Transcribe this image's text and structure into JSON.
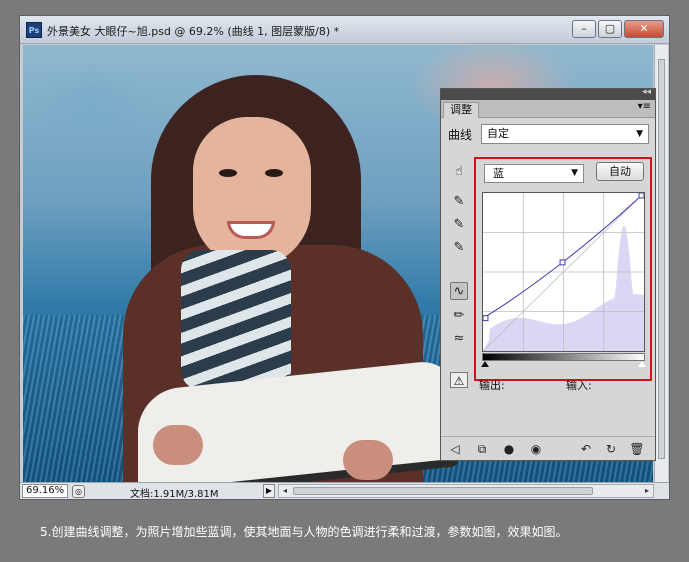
{
  "window": {
    "title": "外景美女  大眼仔~旭.psd @ 69.2% (曲线 1, 图层蒙版/8) *",
    "app_icon": "Ps",
    "buttons": {
      "minimize": "–",
      "restore": "▢",
      "close": "✕"
    }
  },
  "status_bar": {
    "zoom": "69.16%",
    "doc_info": "文档:1.91M/3.81M",
    "arrow": "▶"
  },
  "panel": {
    "tab": "调整",
    "menu_glyph": "▾≡",
    "collapse_glyph": "◂◂",
    "preset_label": "曲线",
    "preset_value": "自定",
    "channel_value": "蓝",
    "auto_label": "自动",
    "output_label": "输出:",
    "input_label": "输入:"
  },
  "tools": [
    {
      "name": "target-adjust-icon",
      "glyph": "☝"
    },
    {
      "name": "black-eyedropper-icon",
      "glyph": "✎"
    },
    {
      "name": "gray-eyedropper-icon",
      "glyph": "✎"
    },
    {
      "name": "white-eyedropper-icon",
      "glyph": "✎"
    },
    {
      "name": "curve-point-icon",
      "glyph": "∿"
    },
    {
      "name": "pencil-icon",
      "glyph": "✏"
    },
    {
      "name": "smooth-icon",
      "glyph": "≈"
    }
  ],
  "footer": [
    {
      "name": "back-icon",
      "glyph": "◁"
    },
    {
      "name": "clip-layer-icon",
      "glyph": "⧉"
    },
    {
      "name": "visibility-mask-icon",
      "glyph": "●"
    },
    {
      "name": "eye-icon",
      "glyph": "◉"
    },
    {
      "name": "previous-state-icon",
      "glyph": "↶"
    },
    {
      "name": "reset-icon",
      "glyph": "↻"
    },
    {
      "name": "trash-icon",
      "glyph": "🗑"
    }
  ],
  "curve": {
    "channel": "蓝",
    "points": [
      [
        0,
        53
      ],
      [
        126,
        143
      ],
      [
        255,
        255
      ]
    ],
    "colors": {
      "curve": "#3a3ab8",
      "histogram": "#d9d7f3",
      "grid": "#bdbdbd",
      "highlight_box": "#c8151b"
    }
  },
  "caption": "5.创建曲线调整，为照片增加些蓝调，使其地面与人物的色调进行柔和过渡，参数如图，效果如图。"
}
